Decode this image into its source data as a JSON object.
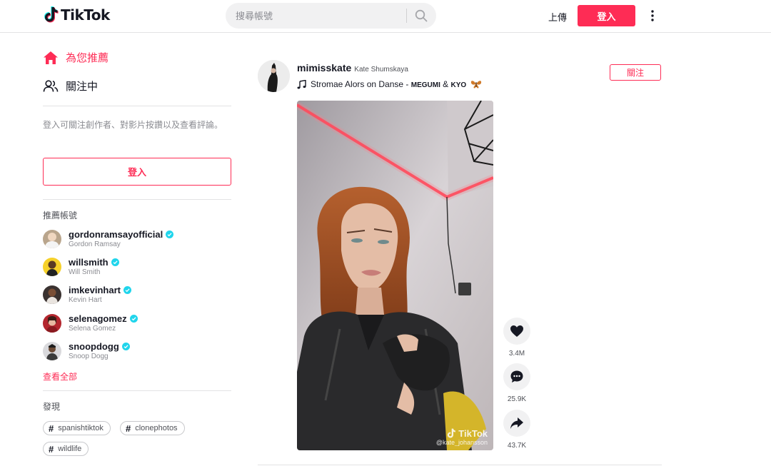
{
  "header": {
    "logo_text": "TikTok",
    "search_placeholder": "搜尋帳號",
    "upload_label": "上傳",
    "login_label": "登入"
  },
  "sidebar": {
    "nav": [
      {
        "label": "為您推薦",
        "icon": "home-icon",
        "active": true
      },
      {
        "label": "關注中",
        "icon": "users-icon",
        "active": false
      }
    ],
    "login_hint": "登入可關注創作者、對影片按讚以及查看評論。",
    "login_button": "登入",
    "suggested_title": "推薦帳號",
    "accounts": [
      {
        "username": "gordonramsayofficial",
        "name": "Gordon Ramsay",
        "verified": true
      },
      {
        "username": "willsmith",
        "name": "Will Smith",
        "verified": true
      },
      {
        "username": "imkevinhart",
        "name": "Kevin Hart",
        "verified": true
      },
      {
        "username": "selenagomez",
        "name": "Selena Gomez",
        "verified": true
      },
      {
        "username": "snoopdogg",
        "name": "Snoop Dogg",
        "verified": true
      }
    ],
    "see_all": "查看全部",
    "discover_title": "發現",
    "tags": [
      "spanishtiktok",
      "clonephotos",
      "wildlife"
    ]
  },
  "post": {
    "username": "mimisskate",
    "nickname": "Kate Shumskaya",
    "music_prefix": "Stromae Alors on Danse - ",
    "music_artists": "MEGUMI",
    "music_amp": " & ",
    "music_artist2": "KYO",
    "follow_label": "關注",
    "watermark_logo": "TikTok",
    "watermark_handle": "@kate_johansson",
    "likes": "3.4M",
    "comments": "25.9K",
    "shares": "43.7K"
  },
  "colors": {
    "accent": "#fe2c55",
    "verified": "#20d5ec",
    "text": "#161823",
    "muted": "#8a8b91"
  }
}
